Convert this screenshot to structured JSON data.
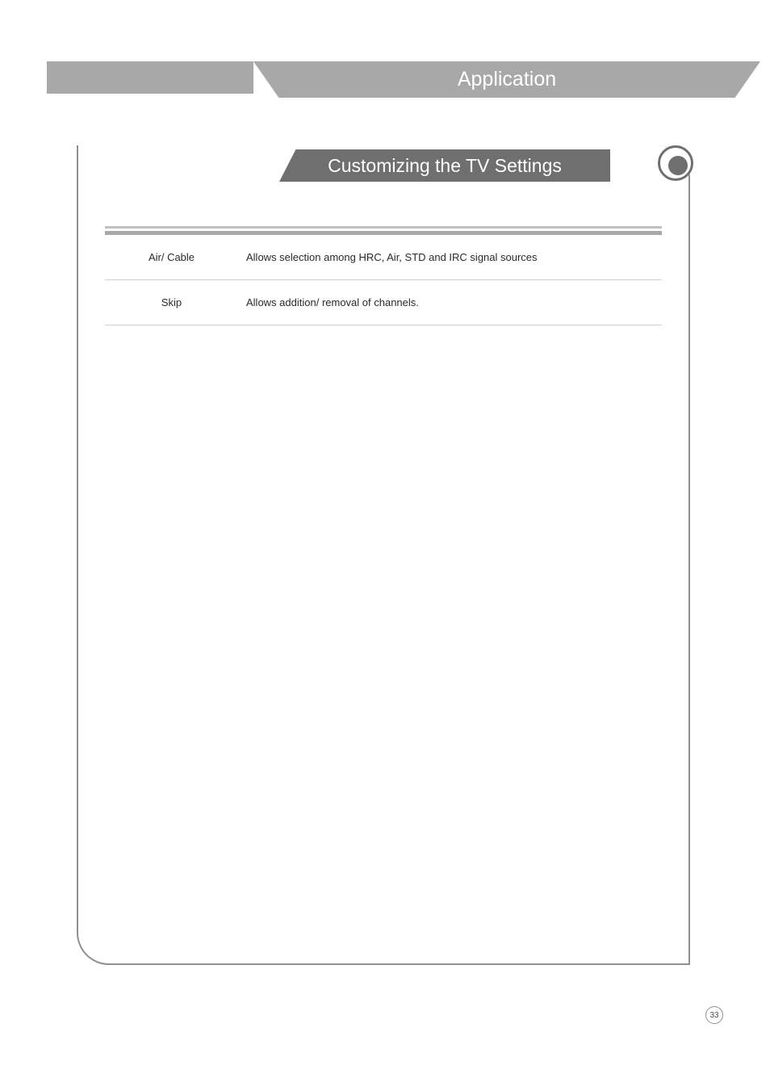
{
  "header": {
    "title": "Application"
  },
  "section": {
    "title": "Customizing the TV Settings"
  },
  "table": {
    "rows": [
      {
        "label": "Air/ Cable",
        "description": "Allows selection among HRC, Air, STD and IRC signal sources"
      },
      {
        "label": "Skip",
        "description": "Allows addition/ removal of channels."
      }
    ]
  },
  "page": {
    "number": "33"
  }
}
